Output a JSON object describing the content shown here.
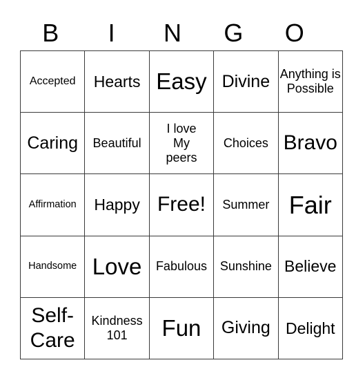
{
  "header": {
    "letters": [
      "B",
      "I",
      "N",
      "G",
      "O"
    ]
  },
  "rows": [
    [
      "Accepted",
      "Hearts",
      "Easy",
      "Divine",
      "Anything is Possible"
    ],
    [
      "Caring",
      "Beautiful",
      "I love My peers",
      "Choices",
      "Bravo"
    ],
    [
      "Affirmation",
      "Happy",
      "Free!",
      "Summer",
      "Fair"
    ],
    [
      "Handsome",
      "Love",
      "Fabulous",
      "Sunshine",
      "Believe"
    ],
    [
      "Self-Care",
      "Kindness 101",
      "Fun",
      "Giving",
      "Delight"
    ]
  ]
}
